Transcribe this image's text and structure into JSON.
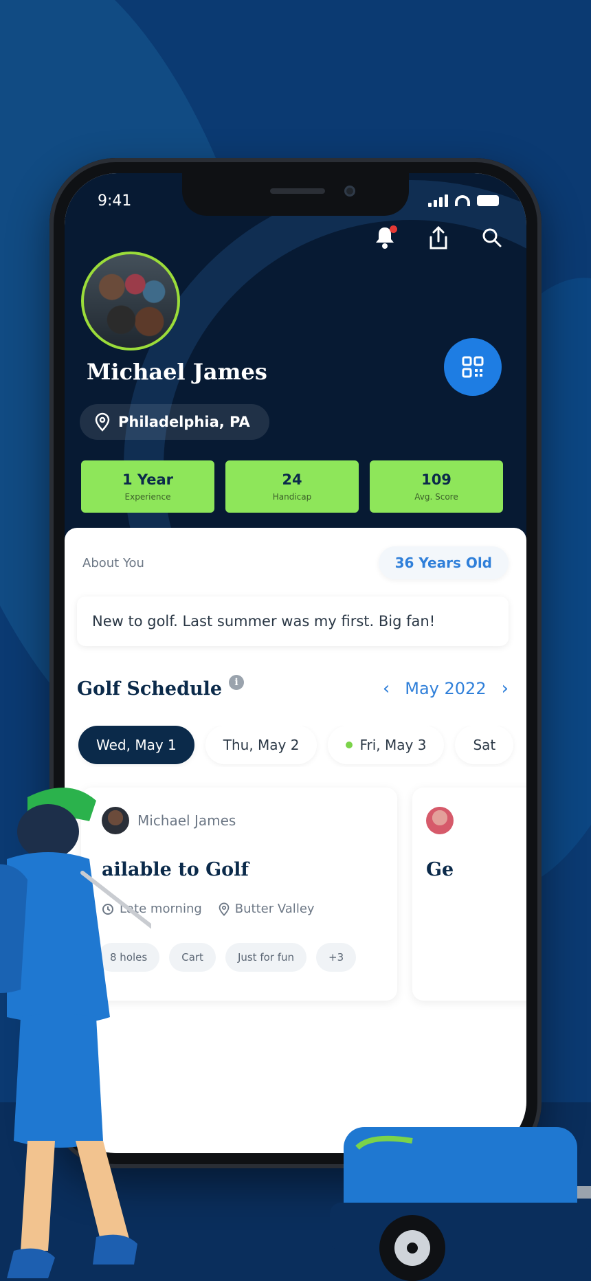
{
  "status_bar": {
    "time": "9:41"
  },
  "profile": {
    "name": "Michael James",
    "location": "Philadelphia, PA",
    "stats": [
      {
        "value": "1 Year",
        "label": "Experience"
      },
      {
        "value": "24",
        "label": "Handicap"
      },
      {
        "value": "109",
        "label": "Avg. Score"
      }
    ]
  },
  "about": {
    "label": "About You",
    "age": "36 Years Old",
    "bio": "New to golf. Last summer was my first. Big fan!"
  },
  "schedule": {
    "title": "Golf Schedule",
    "info": "i",
    "month": "May 2022",
    "days": [
      {
        "label": "Wed, May 1",
        "active": true
      },
      {
        "label": "Thu, May 2"
      },
      {
        "label": "Fri, May 3",
        "dot": true
      },
      {
        "label": "Sat"
      }
    ]
  },
  "card": {
    "host": "Michael James",
    "title": "ailable to Golf",
    "time": "Late morning",
    "place": "Butter Valley",
    "tags": [
      "8 holes",
      "Cart",
      "Just for fun",
      "+3"
    ]
  },
  "card2": {
    "title": "Ge"
  },
  "colors": {
    "background": "#0b3a72",
    "header": "#071a33",
    "accent_blue": "#1e7de3",
    "stat_green": "#8ee65a",
    "notification_red": "#e53935"
  },
  "icons": {
    "bell": "bell-icon",
    "share": "share-icon",
    "search": "search-icon",
    "qr": "qr-code-icon",
    "pin": "map-pin-icon",
    "clock": "clock-icon",
    "prev": "chevron-left-icon",
    "next": "chevron-right-icon"
  }
}
